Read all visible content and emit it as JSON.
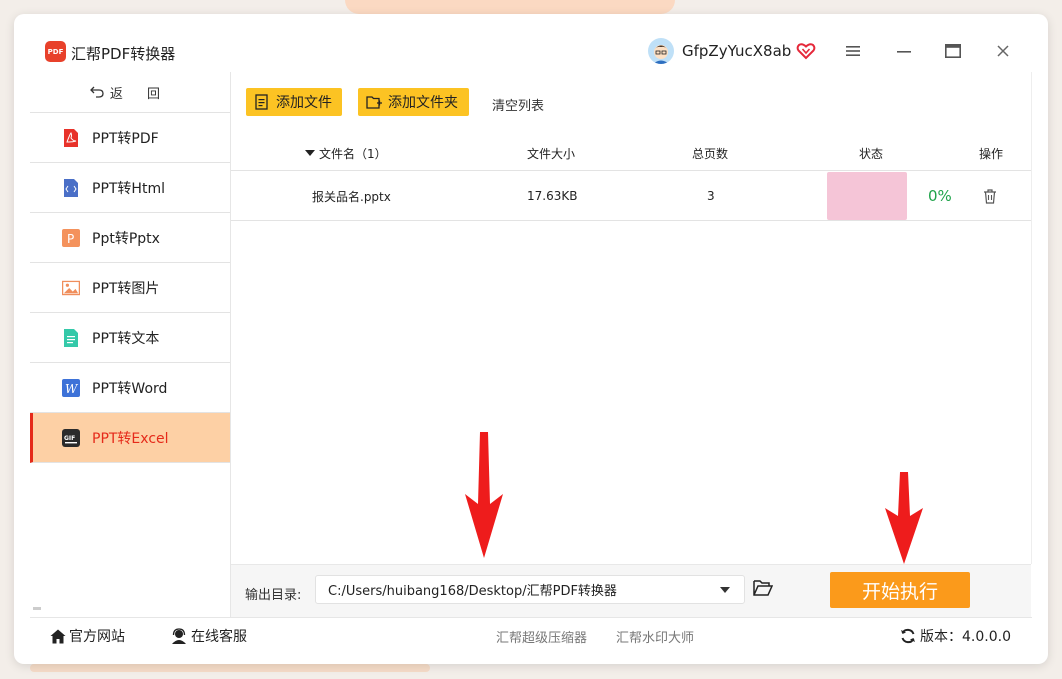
{
  "app": {
    "title": "汇帮PDF转换器",
    "logo_text": "PDF"
  },
  "user": {
    "name": "GfpZyYucX8ab"
  },
  "window_controls": [
    "menu-icon",
    "minimize-icon",
    "maximize-icon",
    "close-icon"
  ],
  "sidebar": {
    "back_label": "返 回",
    "items": [
      {
        "label": "PPT转PDF",
        "icon": "pdf-icon",
        "active": false
      },
      {
        "label": "PPT转Html",
        "icon": "html-file-icon",
        "active": false
      },
      {
        "label": "Ppt转Pptx",
        "icon": "pptx-icon",
        "active": false
      },
      {
        "label": "PPT转图片",
        "icon": "image-icon",
        "active": false
      },
      {
        "label": "PPT转文本",
        "icon": "text-file-icon",
        "active": false
      },
      {
        "label": "PPT转Word",
        "icon": "word-icon",
        "active": false
      },
      {
        "label": "PPT转Excel",
        "icon": "excel-icon",
        "active": true
      }
    ]
  },
  "toolbar": {
    "add_file": "添加文件",
    "add_folder": "添加文件夹",
    "clear_list": "清空列表"
  },
  "table": {
    "headers": {
      "name": "文件名（1）",
      "size": "文件大小",
      "pages": "总页数",
      "status": "状态",
      "action": "操作"
    },
    "rows": [
      {
        "name": "报关品名.pptx",
        "size": "17.63KB",
        "pages": "3",
        "progress": 0,
        "status": "0%"
      }
    ]
  },
  "output": {
    "label": "输出目录:",
    "path": "C:/Users/huibang168/Desktop/汇帮PDF转换器"
  },
  "start_button": "开始执行",
  "footer": {
    "website": "官方网站",
    "support": "在线客服",
    "link1": "汇帮超级压缩器",
    "link2": "汇帮水印大师",
    "version": "版本：4.0.0.0"
  },
  "colors": {
    "accent": "#fb9a1b",
    "toolbar_button": "#fcc323",
    "active_text": "#e52a1a",
    "active_bg": "#fdd0a5",
    "annotation_arrow": "#ee1c1c"
  }
}
